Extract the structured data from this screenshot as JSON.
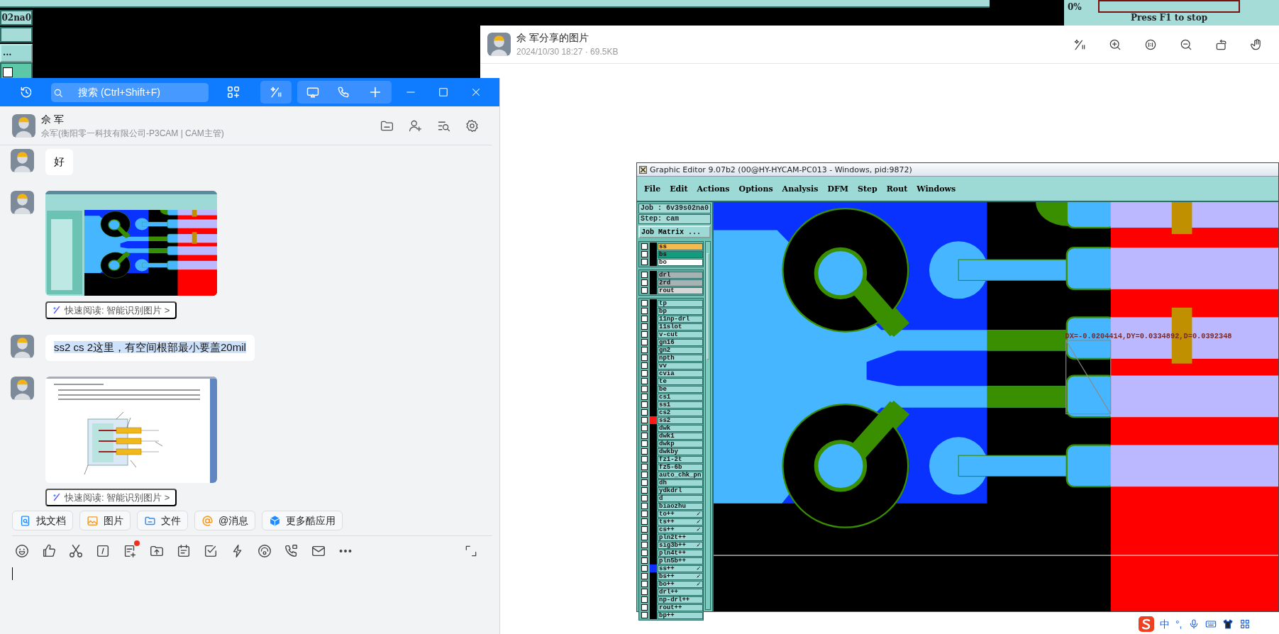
{
  "background_app": {
    "job_fragment": "02na0",
    "button_fragment": "...",
    "progress": "0%",
    "progress_bar": {
      "level": 0
    },
    "stop_hint": "Press F1 to stop"
  },
  "image_viewer": {
    "title": "佘 军分享的图片",
    "meta": "2024/10/30 18:27 · 69.5KB",
    "image": {
      "title": "Graphic Editor 9.07b2 (00@HY-HYCAM-PC013 - Windows, pid:9872)",
      "menus": [
        "File",
        "Edit",
        "Actions",
        "Options",
        "Analysis",
        "DFM",
        "Step",
        "Rout",
        "Windows"
      ],
      "job": "Job : 6v39s02na0",
      "step": "Step: cam",
      "job_matrix": "Job Matrix ...",
      "layer_groups": [
        [
          {
            "name": "ss",
            "kind": "silk",
            "checked": false,
            "pinned": false
          },
          {
            "name": "bs",
            "kind": "mask",
            "checked": false,
            "pinned": false
          },
          {
            "name": "bo",
            "kind": "document",
            "checked": false,
            "pinned": false
          }
        ],
        [
          {
            "name": "drl",
            "kind": "drill",
            "checked": false,
            "pinned": false
          },
          {
            "name": "2rd",
            "kind": "drill",
            "checked": false,
            "pinned": false
          },
          {
            "name": "rout",
            "kind": "rout",
            "checked": false,
            "pinned": false
          }
        ],
        [
          {
            "name": "tp",
            "kind": "misc",
            "checked": false,
            "pinned": false
          },
          {
            "name": "bp",
            "kind": "misc",
            "checked": false,
            "pinned": false
          },
          {
            "name": "11np-drl",
            "kind": "misc",
            "checked": false,
            "pinned": false
          },
          {
            "name": "11slot",
            "kind": "misc",
            "checked": false,
            "pinned": false
          },
          {
            "name": "v-cut",
            "kind": "misc",
            "checked": false,
            "pinned": false
          },
          {
            "name": "gn16",
            "kind": "misc",
            "checked": false,
            "pinned": false
          },
          {
            "name": "gn2",
            "kind": "misc",
            "checked": false,
            "pinned": false
          },
          {
            "name": "npth",
            "kind": "misc",
            "checked": false,
            "pinned": false
          },
          {
            "name": "vv",
            "kind": "misc",
            "checked": false,
            "pinned": false
          },
          {
            "name": "cvia",
            "kind": "misc",
            "checked": false,
            "pinned": false
          },
          {
            "name": "te",
            "kind": "misc",
            "checked": false,
            "pinned": false
          },
          {
            "name": "be",
            "kind": "misc",
            "checked": false,
            "pinned": false
          },
          {
            "name": "cs1",
            "kind": "misc",
            "checked": false,
            "pinned": false
          },
          {
            "name": "ss1",
            "kind": "misc",
            "checked": false,
            "pinned": false
          },
          {
            "name": "cs2",
            "kind": "misc",
            "checked": false,
            "pinned": false
          },
          {
            "name": "ss2",
            "kind": "misc",
            "checked": false,
            "pinned": false,
            "color": "#ff1a1a"
          },
          {
            "name": "dwk",
            "kind": "misc",
            "checked": false,
            "pinned": false
          },
          {
            "name": "dwk1",
            "kind": "misc",
            "checked": false,
            "pinned": false
          },
          {
            "name": "dwkp",
            "kind": "misc",
            "checked": false,
            "pinned": false
          },
          {
            "name": "dwkby",
            "kind": "misc",
            "checked": false,
            "pinned": false
          },
          {
            "name": "fz1-2t",
            "kind": "misc",
            "checked": false,
            "pinned": false
          },
          {
            "name": "fz5-6b",
            "kind": "misc",
            "checked": false,
            "pinned": false
          },
          {
            "name": "auto_chk_pn",
            "kind": "misc",
            "checked": false,
            "pinned": false
          },
          {
            "name": "dh",
            "kind": "misc",
            "checked": false,
            "pinned": false
          },
          {
            "name": "ydkdrl",
            "kind": "misc",
            "checked": false,
            "pinned": false
          },
          {
            "name": "d",
            "kind": "misc",
            "checked": false,
            "pinned": false
          },
          {
            "name": "biaozhu",
            "kind": "misc",
            "checked": false,
            "pinned": false
          },
          {
            "name": "to++",
            "kind": "misc",
            "checked": false,
            "pinned": true
          },
          {
            "name": "ts++",
            "kind": "misc",
            "checked": false,
            "pinned": true
          },
          {
            "name": "cs++",
            "kind": "misc",
            "checked": false,
            "pinned": true
          },
          {
            "name": "pln2t++",
            "kind": "misc",
            "checked": false,
            "pinned": false
          },
          {
            "name": "sig3b++",
            "kind": "misc",
            "checked": false,
            "pinned": true
          },
          {
            "name": "pln4t++",
            "kind": "misc",
            "checked": false,
            "pinned": false
          },
          {
            "name": "pln5b++",
            "kind": "misc",
            "checked": false,
            "pinned": false
          },
          {
            "name": "ss++",
            "kind": "misc",
            "checked": false,
            "pinned": true,
            "color": "#1030ff"
          },
          {
            "name": "bs++",
            "kind": "misc",
            "checked": false,
            "pinned": true
          },
          {
            "name": "bo++",
            "kind": "misc",
            "checked": false,
            "pinned": true
          },
          {
            "name": "drl++",
            "kind": "misc",
            "checked": false,
            "pinned": false
          },
          {
            "name": "np-drl++",
            "kind": "misc",
            "checked": false,
            "pinned": false
          },
          {
            "name": "rout++",
            "kind": "misc",
            "checked": false,
            "pinned": false
          },
          {
            "name": "bp++",
            "kind": "misc",
            "checked": false,
            "pinned": false
          }
        ]
      ],
      "measurement": "DX=-0.0204414,DY=0.0334892,D=0.0392348"
    }
  },
  "chat": {
    "search_placeholder": "搜索 (Ctrl+Shift+F)",
    "contact": {
      "name": "佘 军",
      "subtitle": "佘军(衡阳零一科技有限公司-P3CAM | CAM主管)"
    },
    "messages": [
      {
        "kind": "text",
        "text": "好",
        "selected": false
      },
      {
        "kind": "pcb-image",
        "quick_read": "快速阅读: 智能识别图片 >"
      },
      {
        "kind": "text",
        "text": "ss2 cs 2这里，有空间根部最小要盖20mil",
        "selected": true
      },
      {
        "kind": "document-image",
        "quick_read": "快速阅读: 智能识别图片 >"
      }
    ],
    "quick_actions": [
      {
        "kind": "find-doc",
        "label": "找文档"
      },
      {
        "kind": "picture",
        "label": "图片"
      },
      {
        "kind": "file",
        "label": "文件"
      },
      {
        "kind": "mention",
        "label": "@消息"
      },
      {
        "kind": "apps",
        "label": "更多酷应用"
      }
    ],
    "input_tools": [
      {
        "kind": "emoji",
        "dot": false
      },
      {
        "kind": "thumbs-up",
        "dot": false
      },
      {
        "kind": "scissors",
        "dot": false
      },
      {
        "kind": "slash-box",
        "dot": false
      },
      {
        "kind": "note-add",
        "dot": true
      },
      {
        "kind": "folder-upload",
        "dot": false
      },
      {
        "kind": "calendar",
        "dot": false
      },
      {
        "kind": "checkbox",
        "dot": false
      },
      {
        "kind": "lightning",
        "dot": false
      },
      {
        "kind": "call",
        "dot": false
      },
      {
        "kind": "video-call",
        "dot": false
      },
      {
        "kind": "mail",
        "dot": false
      },
      {
        "kind": "more",
        "dot": false
      }
    ]
  },
  "ime_bar": {
    "mode": "中",
    "punctuation": "°,"
  }
}
